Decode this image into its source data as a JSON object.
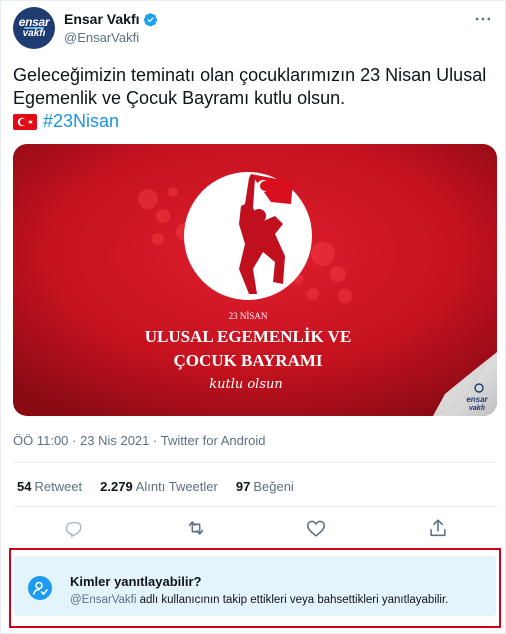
{
  "author": {
    "display_name": "Ensar Vakfı",
    "handle": "@EnsarVakfi",
    "avatar_text_top": "ensar",
    "avatar_text_bottom": "vakfı"
  },
  "tweet": {
    "text": "Geleceğimizin teminatı olan çocuklarımızın 23 Nisan Ulusal Egemenlik ve Çocuk Bayramı kutlu olsun.",
    "hashtag": "#23Nisan"
  },
  "media": {
    "date_line": "23 NİSAN",
    "title_line1": "ULUSAL EGEMENLİK VE",
    "title_line2": "ÇOCUK BAYRAMI",
    "script_line": "kutlu olsun",
    "corner_logo_top": "ensar",
    "corner_logo_bottom": "vakfı"
  },
  "meta": {
    "time": "ÖÖ 11:00",
    "date": "23 Nis 2021",
    "source": "Twitter for Android",
    "separator": "·"
  },
  "stats": {
    "retweets_count": "54",
    "retweets_label": "Retweet",
    "quotes_count": "2.279",
    "quotes_label": "Alıntı Tweetler",
    "likes_count": "97",
    "likes_label": "Beğeni"
  },
  "reply_settings": {
    "title": "Kimler yanıtlayabilir?",
    "handle": "@EnsarVakfi",
    "description": " adlı kullanıcının takip ettikleri veya bahsettikleri yanıtlayabilir."
  },
  "colors": {
    "accent": "#1b95e0",
    "verified": "#1da1f2",
    "muted": "#5b7083",
    "highlight_border": "#d0021b",
    "banner_red": "#c8102e"
  },
  "icons": [
    "verified-badge-icon",
    "more-options-icon",
    "turkish-flag-icon",
    "reply-icon",
    "retweet-icon",
    "like-icon",
    "share-icon",
    "reply-settings-icon"
  ]
}
